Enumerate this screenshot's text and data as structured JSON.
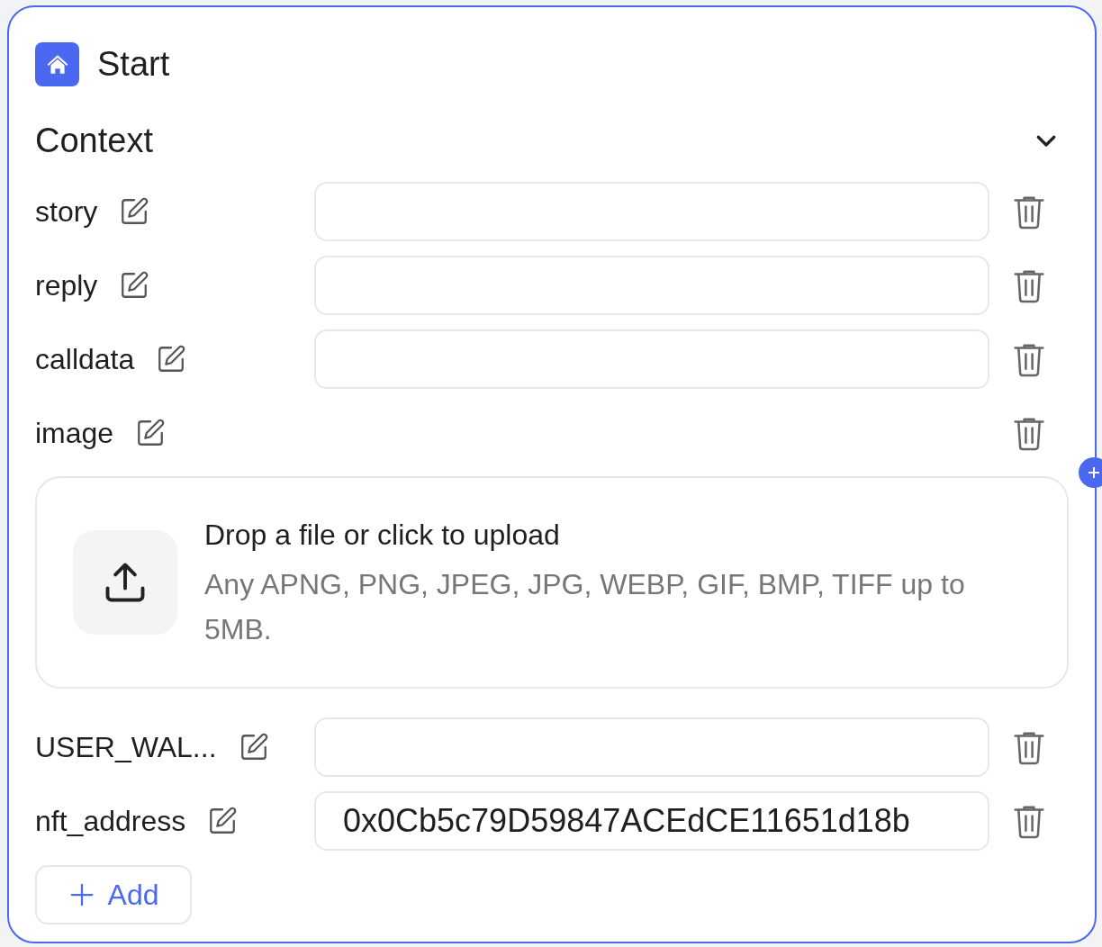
{
  "node": {
    "title": "Start"
  },
  "section": {
    "title": "Context",
    "expanded": true
  },
  "fields": [
    {
      "name": "story",
      "kind": "text"
    },
    {
      "name": "reply",
      "kind": "text"
    },
    {
      "name": "calldata",
      "kind": "text"
    },
    {
      "name": "image",
      "kind": "file",
      "upload": {
        "title": "Drop a file or click to upload",
        "hint": "Any APNG, PNG, JPEG, JPG, WEBP, GIF, BMP, TIFF up to 5MB."
      }
    },
    {
      "name": "USER_WAL...",
      "kind": "text"
    },
    {
      "name": "nft_address",
      "kind": "text",
      "value": "0x0Cb5c79D59847ACEdCE11651d18b"
    }
  ],
  "add_button": {
    "label": "Add"
  }
}
